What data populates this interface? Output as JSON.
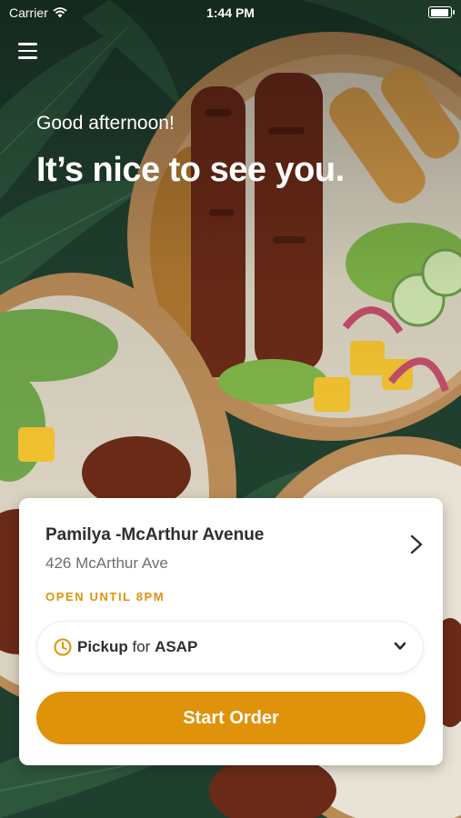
{
  "status_bar": {
    "carrier": "Carrier",
    "time": "1:44 PM"
  },
  "header": {
    "greeting": "Good afternoon!",
    "welcome": "It’s nice to see you."
  },
  "location": {
    "name": "Pamilya -McArthur Avenue",
    "address": "426 McArthur Ave",
    "hours": "OPEN UNTIL 8PM"
  },
  "order_mode": {
    "mode": "Pickup",
    "connector": "for",
    "time": "ASAP"
  },
  "actions": {
    "start_order": "Start Order"
  },
  "colors": {
    "accent": "#E0920B",
    "text_dark": "#2E2E2E",
    "text_muted": "#6F6F6F"
  },
  "icons": [
    "wifi-icon",
    "battery-icon",
    "hamburger-menu-icon",
    "chevron-right-icon",
    "clock-icon",
    "chevron-down-icon"
  ]
}
